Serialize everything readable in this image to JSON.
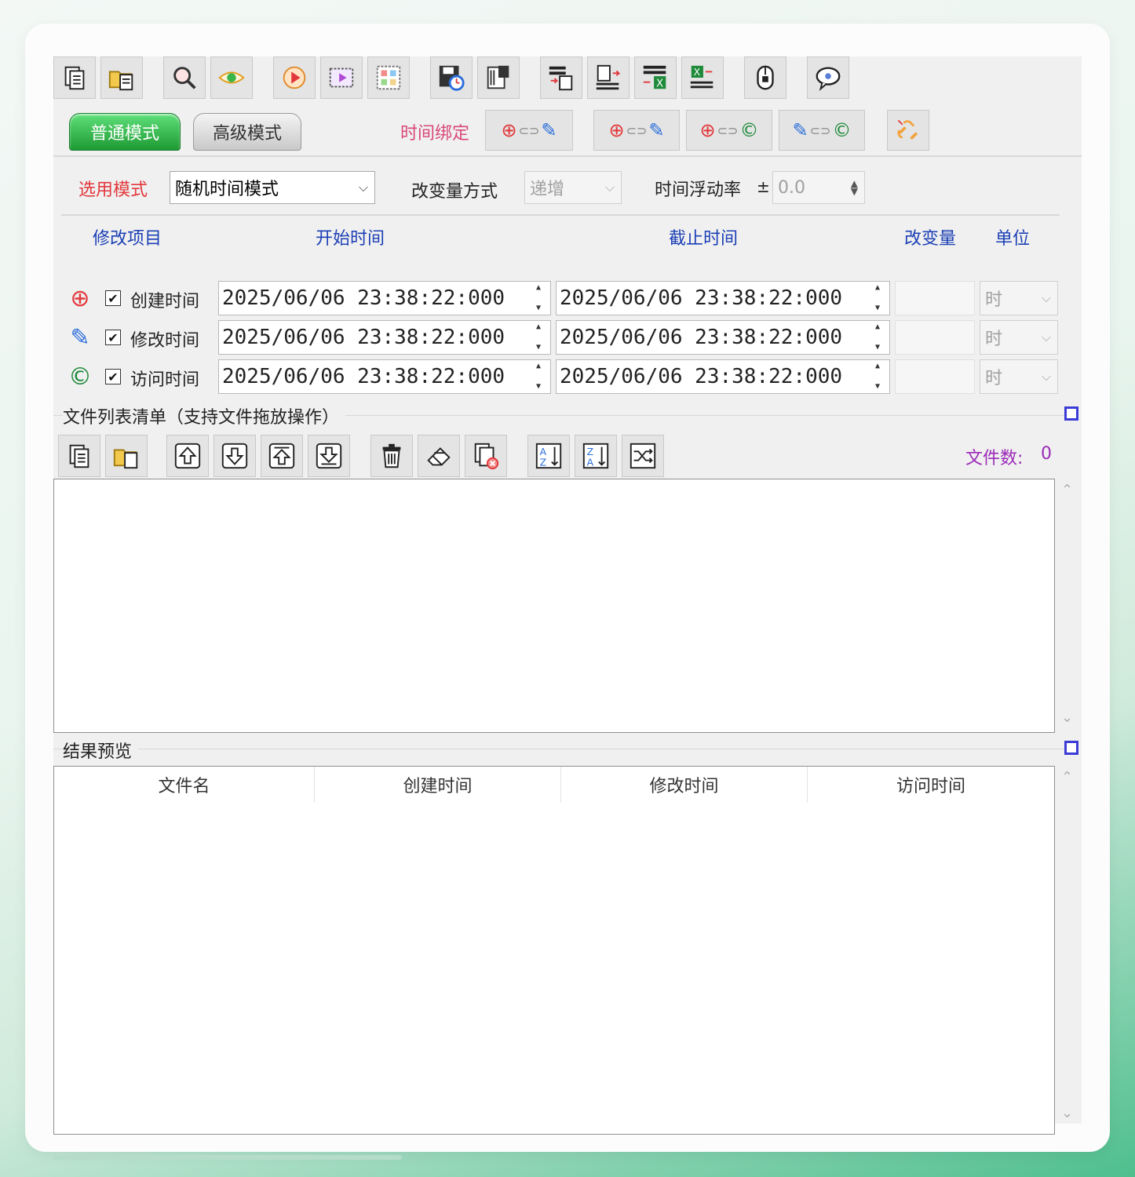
{
  "toolbar": {
    "buttons": [
      {
        "name": "add-files-button",
        "icon": "copy-files-icon"
      },
      {
        "name": "add-folder-button",
        "icon": "folder-files-icon"
      },
      {
        "name": "search-button",
        "icon": "magnifier-icon"
      },
      {
        "name": "preview-button",
        "icon": "eye-icon"
      },
      {
        "name": "play-button",
        "icon": "play-icon"
      },
      {
        "name": "select-frame-button",
        "icon": "frame-select-icon"
      },
      {
        "name": "grid-select-button",
        "icon": "grid-icon"
      },
      {
        "name": "save-time-button",
        "icon": "disk-clock-icon"
      },
      {
        "name": "load-button",
        "icon": "folder-disk-icon"
      },
      {
        "name": "import-list-button",
        "icon": "import-list-icon"
      },
      {
        "name": "export-list-button",
        "icon": "export-list-icon"
      },
      {
        "name": "import-excel-button",
        "icon": "import-excel-icon"
      },
      {
        "name": "export-excel-button",
        "icon": "export-excel-icon"
      },
      {
        "name": "mouse-button",
        "icon": "mouse-icon"
      },
      {
        "name": "message-button",
        "icon": "speech-bubble-icon"
      }
    ]
  },
  "modes": {
    "normal": "普通模式",
    "advanced": "高级模式"
  },
  "binding": {
    "label": "时间绑定"
  },
  "options": {
    "mode_label": "选用模式",
    "mode_value": "随机时间模式",
    "change_label": "改变量方式",
    "change_value": "递增",
    "float_label": "时间浮动率",
    "float_pm": "±",
    "float_value": "0.0"
  },
  "table_headers": {
    "item": "修改项目",
    "start": "开始时间",
    "end": "截止时间",
    "delta": "改变量",
    "unit": "单位"
  },
  "rows": [
    {
      "label": "创建时间",
      "start": "2025/06/06 23:38:22:000",
      "end": "2025/06/06 23:38:22:000",
      "delta": "",
      "unit": "时",
      "checked": "✔"
    },
    {
      "label": "修改时间",
      "start": "2025/06/06 23:38:22:000",
      "end": "2025/06/06 23:38:22:000",
      "delta": "",
      "unit": "时",
      "checked": "✔"
    },
    {
      "label": "访问时间",
      "start": "2025/06/06 23:38:22:000",
      "end": "2025/06/06 23:38:22:000",
      "delta": "",
      "unit": "时",
      "checked": "✔"
    }
  ],
  "file_list": {
    "title": "文件列表清单（支持文件拖放操作）",
    "count_label": "文件数:",
    "count_value": "0"
  },
  "preview": {
    "title": "结果预览",
    "columns": [
      "文件名",
      "创建时间",
      "修改时间",
      "访问时间"
    ]
  },
  "colors": {
    "accent_green": "#2fbf4e",
    "label_red": "#e2383c",
    "header_blue": "#1b3fb5",
    "count_purple": "#9b2ab8"
  }
}
